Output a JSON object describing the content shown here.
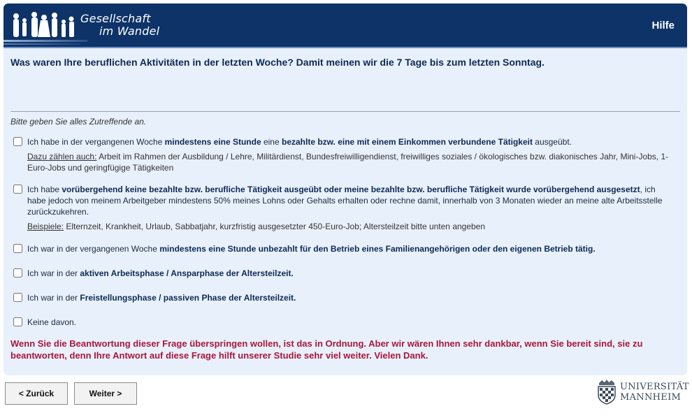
{
  "header": {
    "logo_line1": "Gesellschaft",
    "logo_line2": "im Wandel",
    "help_label": "Hilfe"
  },
  "question": {
    "text": "Was waren Ihre beruflichen Aktivitäten in der letzten Woche? Damit meinen wir die 7 Tage bis zum letzten Sonntag.",
    "instruction": "Bitte geben Sie alles Zutreffende an."
  },
  "options": {
    "o1": {
      "p1": "Ich habe in der vergangenen Woche ",
      "b1": "mindestens eine Stunde",
      "p2": " eine ",
      "b2": "bezahlte bzw. eine mit einem Einkommen verbundene Tätigkeit",
      "p3": " ausgeübt.",
      "sub_label": "Dazu zählen auch:",
      "sub_text": " Arbeit im Rahmen der Ausbildung / Lehre, Militärdienst, Bundesfreiwilligendienst, freiwilliges soziales / ökologisches bzw. diakonisches Jahr, Mini-Jobs, 1-Euro-Jobs und geringfügige Tätigkeiten",
      "checked": false
    },
    "o2": {
      "p1": "Ich habe ",
      "b1": "vorübergehend keine bezahlte bzw. berufliche Tätigkeit ausgeübt oder meine bezahlte bzw. berufliche Tätigkeit wurde vorübergehend ausgesetzt",
      "p2": ", ich habe jedoch von meinem Arbeitgeber mindestens 50% meines Lohns oder Gehalts erhalten oder rechne damit, innerhalb von 3 Monaten wieder an meine alte Arbeitsstelle zurückzukehren.",
      "sub_label": "Beispiele:",
      "sub_text": " Elternzeit, Krankheit, Urlaub, Sabbatjahr, kurzfristig ausgesetzter 450-Euro-Job; Altersteilzeit bitte unten angeben",
      "checked": false
    },
    "o3": {
      "p1": "Ich war in der vergangenen Woche ",
      "b1": "mindestens eine Stunde unbezahlt für den Betrieb eines Familienangehörigen oder den eigenen Betrieb tätig.",
      "checked": false
    },
    "o4": {
      "p1": "Ich war in der ",
      "b1": "aktiven Arbeitsphase / Ansparphase der Altersteilzeit.",
      "checked": false
    },
    "o5": {
      "p1": "Ich war in der ",
      "b1": "Freistellungsphase / passiven Phase der Altersteilzeit.",
      "checked": false
    },
    "o6": {
      "p1": "Keine davon.",
      "checked": false
    }
  },
  "hint": "Wenn Sie die Beantwortung dieser Frage überspringen wollen, ist das in Ordnung. Aber wir wären Ihnen sehr dankbar, wenn Sie bereit sind, sie zu beantworten, denn Ihre Antwort auf diese Frage hilft unserer Studie sehr viel weiter. Vielen Dank.",
  "nav": {
    "back_label": "< Zurück",
    "next_label": "Weiter >"
  },
  "university": {
    "line1": "UNIVERSITÄT",
    "line2": "MANNHEIM"
  },
  "colors": {
    "header_bg": "#0d3368",
    "panel_bg": "#e8f0fb",
    "hint_red": "#a8173b"
  }
}
